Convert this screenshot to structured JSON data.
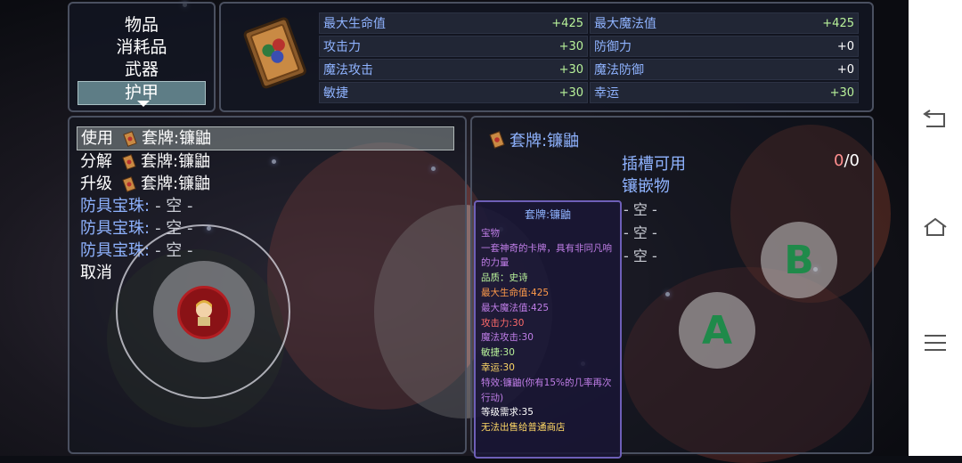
{
  "categories": [
    "物品",
    "消耗品",
    "武器",
    "护甲"
  ],
  "selected_category_index": 3,
  "item_stats": [
    {
      "name": "最大生命值",
      "value": "+425",
      "name2": "最大魔法值",
      "value2": "+425"
    },
    {
      "name": "攻击力",
      "value": "+30",
      "name2": "防御力",
      "value2": "+0"
    },
    {
      "name": "魔法攻击",
      "value": "+30",
      "name2": "魔法防御",
      "value2": "+0"
    },
    {
      "name": "敏捷",
      "value": "+30",
      "name2": "幸运",
      "value2": "+30"
    }
  ],
  "command_menu": {
    "use_label": "使用",
    "disassemble_label": "分解",
    "upgrade_label": "升级",
    "item_name": "套牌:镰鼬",
    "gem_slot_label": "防具宝珠:",
    "empty_label": "- 空 -",
    "cancel_label": "取消"
  },
  "detail": {
    "title": "套牌:镰鼬",
    "socket_label": "插槽可用",
    "socket_label2": "镶嵌物",
    "socket_used": "0",
    "socket_total": "/0",
    "slots": [
      "- 空 -",
      "- 空 -",
      "- 空 -"
    ]
  },
  "tooltip": {
    "title": "套牌:镰鼬",
    "type": "宝物",
    "desc": "一套神奇的卡牌，具有非同凡响的力量",
    "quality": "品质：史诗",
    "hp": "最大生命值:425",
    "mp": "最大魔法值:425",
    "atk": "攻击力:30",
    "matk": "魔法攻击:30",
    "agi": "敏捷:30",
    "luck": "幸运:30",
    "effect": "特效:镰鼬(你有15%的几率再次行动)",
    "level_req": "等级需求:35",
    "no_sell": "无法出售给普通商店"
  },
  "buttons": {
    "a": "A",
    "b": "B"
  },
  "icons": [
    "card-deck-icon",
    "joystick-character-icon",
    "back-icon",
    "home-icon",
    "menu-icon"
  ]
}
